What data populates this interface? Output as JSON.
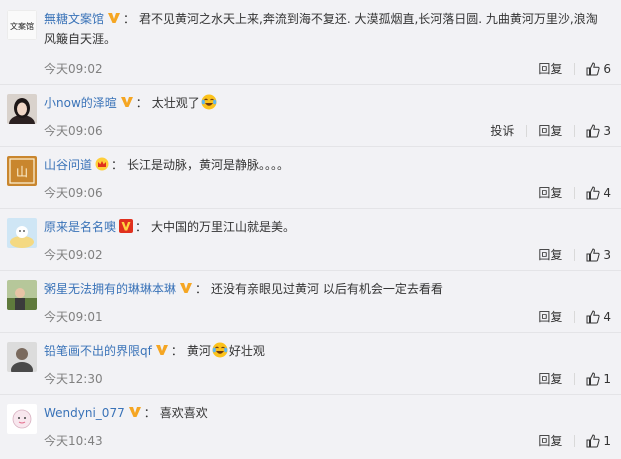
{
  "actions": {
    "reply": "回复",
    "report": "投诉"
  },
  "comments": [
    {
      "user": "無糖文案馆",
      "badge": "v-gold",
      "text": "君不见黄河之水天上来,奔流到海不复还. 大漠孤烟直,长河落日圆. 九曲黄河万里沙,浪淘风簸自天涯。",
      "time": "今天09:02",
      "likes": "6",
      "has_report": false
    },
    {
      "user": "小now的泽暄",
      "badge": "v-gold",
      "text_before": "太壮观了",
      "emoji": "crying-laughing-emoji",
      "text_after": "",
      "time": "今天09:06",
      "likes": "3",
      "has_report": true
    },
    {
      "user": "山谷问道",
      "badge": "crown",
      "text": "长江是动脉，黄河是静脉。。。。",
      "time": "今天09:06",
      "likes": "4",
      "has_report": false
    },
    {
      "user": "原来是名名噢",
      "badge": "v-red",
      "text": "大中国的万里江山就是美。",
      "time": "今天09:02",
      "likes": "3",
      "has_report": false
    },
    {
      "user": "粥星无法拥有的琳琳本琳",
      "badge": "v-gold",
      "text": "还没有亲眼见过黄河 以后有机会一定去看看",
      "time": "今天09:01",
      "likes": "4",
      "has_report": false
    },
    {
      "user": "铅笔画不出的界限qf",
      "badge": "v-gold",
      "text_before": "黄河",
      "emoji": "crying-laughing-emoji",
      "text_after": "好壮观",
      "time": "今天12:30",
      "likes": "1",
      "has_report": false
    },
    {
      "user": "Wendyni_077",
      "badge": "v-gold",
      "text": "喜欢喜欢",
      "time": "今天10:43",
      "likes": "1",
      "has_report": false
    }
  ],
  "colors": {
    "username": "#3a73b8",
    "v_gold": "#f5a623",
    "v_red": "#e0301e",
    "time": "#808080",
    "background": "#f2f2f5"
  }
}
